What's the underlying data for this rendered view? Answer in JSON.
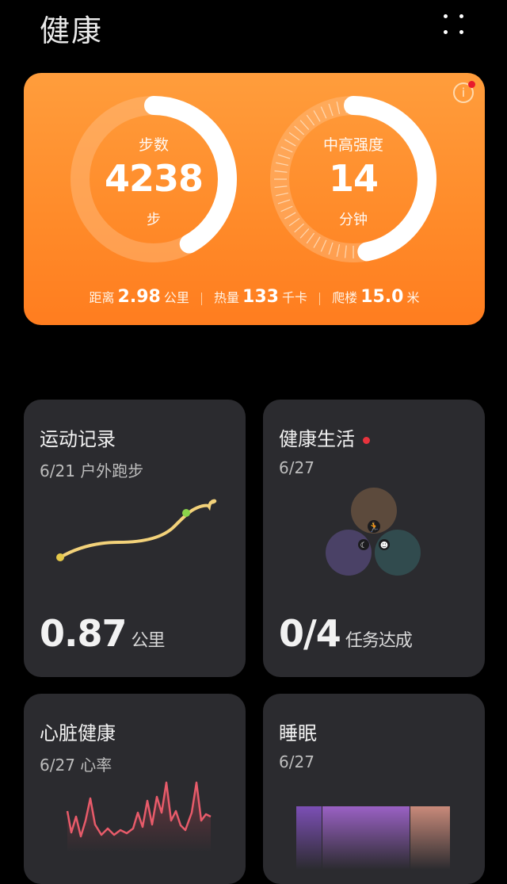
{
  "header": {
    "title": "健康",
    "more_icon": "more-grid-icon"
  },
  "summary": {
    "steps": {
      "caption": "步数",
      "value": "4238",
      "unit": "步",
      "progress": 0.42
    },
    "intensity": {
      "caption": "中高强度",
      "value": "14",
      "unit": "分钟",
      "progress": 0.47
    },
    "stats": [
      {
        "label": "距离",
        "value": "2.98",
        "unit": "公里"
      },
      {
        "label": "热量",
        "value": "133",
        "unit": "千卡"
      },
      {
        "label": "爬楼",
        "value": "15.0",
        "unit": "米"
      }
    ],
    "info_icon": "info-icon",
    "colors": {
      "start": "#ff9d3c",
      "end": "#ff7d1f"
    }
  },
  "cards": {
    "exercise": {
      "title": "运动记录",
      "date": "6/21 户外跑步",
      "value": "0.87",
      "unit": "公里"
    },
    "lifestyle": {
      "title": "健康生活",
      "date": "6/27",
      "value": "0/4",
      "unit": "任务达成"
    },
    "heart": {
      "title": "心脏健康",
      "date": "6/27 心率"
    },
    "sleep": {
      "title": "睡眠",
      "date": "6/27"
    }
  }
}
